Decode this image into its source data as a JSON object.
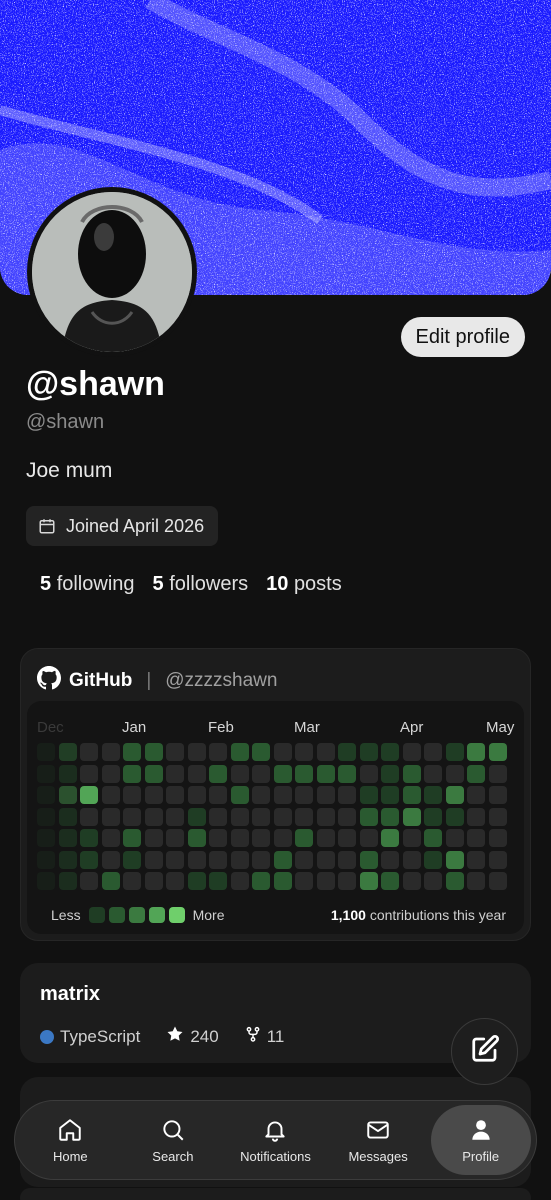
{
  "profile": {
    "display_name": "@shawn",
    "handle": "@shawn",
    "bio": "Joe mum",
    "joined": "Joined April 2026",
    "edit_label": "Edit profile"
  },
  "stats": {
    "following_count": "5",
    "following_label": "following",
    "followers_count": "5",
    "followers_label": "followers",
    "posts_count": "10",
    "posts_label": "posts"
  },
  "github": {
    "title": "GitHub",
    "username": "@zzzzshawn",
    "months": [
      "Dec",
      "Jan",
      "Feb",
      "Mar",
      "Apr",
      "May"
    ],
    "legend_less": "Less",
    "legend_more": "More",
    "legend_colors": [
      "#1f3d24",
      "#2a5a30",
      "#3b7a40",
      "#52a556",
      "#6fcf6b"
    ],
    "contrib_count": "1,100",
    "contrib_label": "contributions this year"
  },
  "repo": {
    "name": "matrix",
    "language": "TypeScript",
    "language_color": "#3b78c4",
    "stars": "240",
    "forks": "11"
  },
  "icons": {
    "joined": "calendar-icon",
    "github": "github-icon",
    "star": "star-icon",
    "fork": "fork-icon",
    "fab": "compose-icon"
  },
  "nav": {
    "home": "Home",
    "search": "Search",
    "notifications": "Notifications",
    "messages": "Messages",
    "profile": "Profile"
  },
  "colors": {
    "banner": "#1a1aff",
    "background": "#111111",
    "card": "#1c1c1c"
  }
}
